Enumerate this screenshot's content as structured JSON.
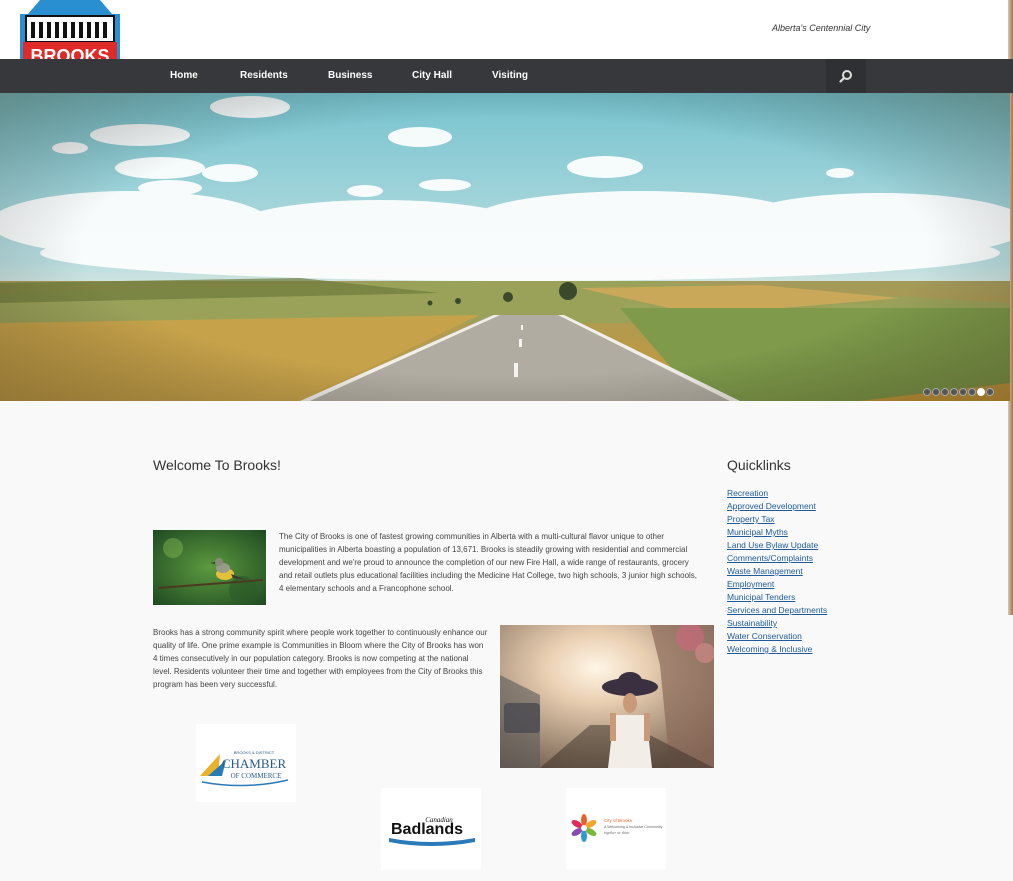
{
  "header": {
    "logo_text": "BROOKS",
    "tagline": "Alberta's Centennial City"
  },
  "nav": {
    "items": [
      {
        "label": "Home"
      },
      {
        "label": "Residents"
      },
      {
        "label": "Business"
      },
      {
        "label": "City Hall"
      },
      {
        "label": "Visiting"
      }
    ],
    "search_icon": "search-icon"
  },
  "hero": {
    "slide_count": 7,
    "active_slide": 6
  },
  "main": {
    "title": "Welcome To Brooks!",
    "paragraph1": "The City of Brooks is one of fastest growing communities in Alberta with a multi-cultural flavor unique to other municipalities in Alberta boasting a population of 13,671. Brooks is steadily growing with residential and commercial development and we're proud to announce the completion of our new Fire Hall, a wide range of restaurants, grocery and retail outlets plus educational facilities including the Medicine Hat College, two high schools, 3 junior high schools, 4 elementary schools and a Francophone school.",
    "paragraph2": "Brooks has a strong community spirit where people work together to continuously enhance our quality of life. One prime example is Communities in Bloom where the City of Brooks has won 4 times consecutively in our population category. Brooks is now competing at the national level. Residents volunteer their time and together with employees from the City of Brooks this program has been very successful."
  },
  "partner_logos": {
    "chamber_small": "BROOKS & DISTRICT",
    "chamber_big": "CHAMBER",
    "chamber_of": "OF COMMERCE",
    "badlands_small": "Canadian",
    "badlands_big": "Badlands",
    "cob_title": "City of Brooks",
    "cob_sub": "A Welcoming & Inclusive Community",
    "cob_slogan": "together we shine"
  },
  "quicklinks": {
    "title": "Quicklinks",
    "links": [
      "Recreation",
      "Approved Development",
      "Property Tax",
      "Municipal Myths",
      "Land Use Bylaw Update",
      "Comments/Complaints",
      "Waste Management",
      "Employment",
      "Municipal Tenders",
      "Services and Departments",
      "Sustainability",
      "Water Conservation",
      "Welcoming & Inclusive"
    ]
  },
  "colors": {
    "nav_bg": "#36383c",
    "link": "#1f5b9c",
    "logo_red": "#e02a28",
    "logo_blue": "#2a8fd0"
  }
}
